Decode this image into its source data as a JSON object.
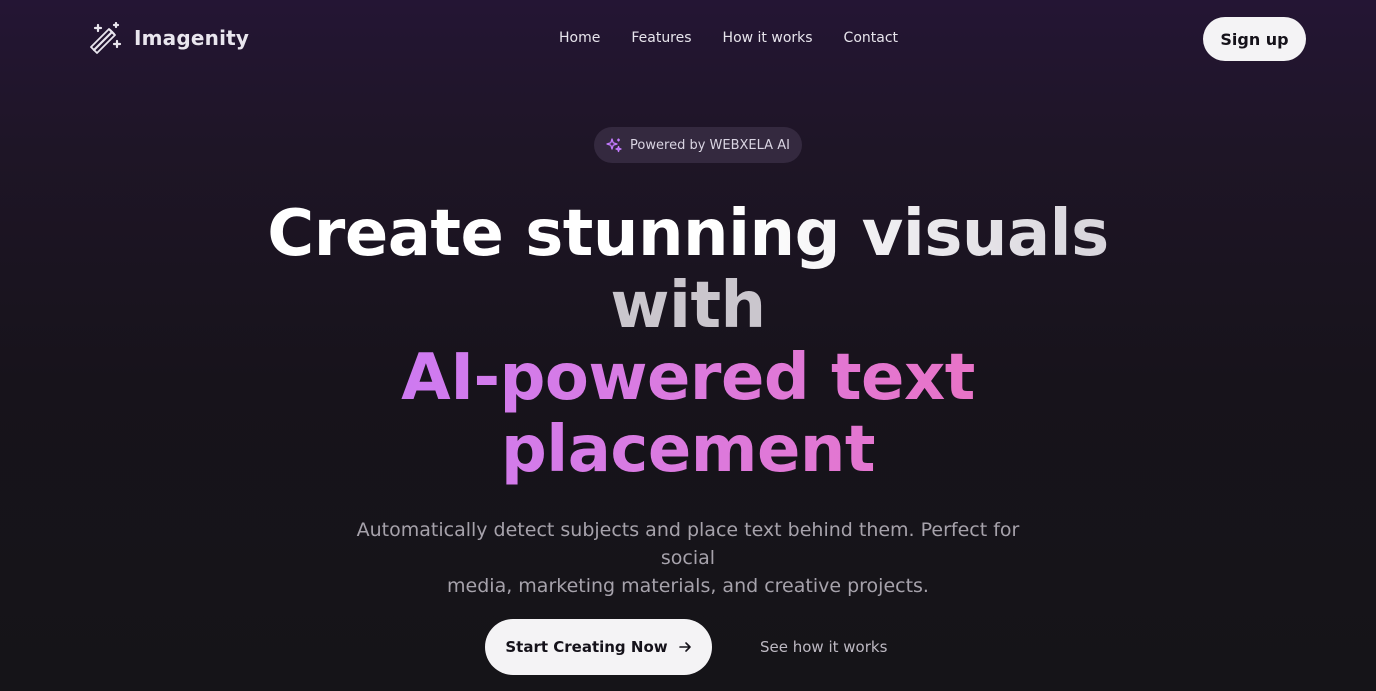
{
  "nav": {
    "brand": "Imagenity",
    "brand_icon": "magic-wand-icon",
    "links": [
      {
        "label": "Home"
      },
      {
        "label": "Features"
      },
      {
        "label": "How it works"
      },
      {
        "label": "Contact"
      }
    ],
    "signup_label": "Sign up"
  },
  "hero": {
    "badge": {
      "icon": "sparkles-icon",
      "text": "Powered by WEBXELA AI"
    },
    "headline": {
      "line1": "Create stunning visuals",
      "line2": "with",
      "line3": "AI-powered text",
      "line4": "placement"
    },
    "subtext_line1": "Automatically detect subjects and place text behind them. Perfect for social",
    "subtext_line2": "media, marketing materials, and creative projects.",
    "cta_primary": {
      "label": "Start Creating Now",
      "icon": "arrow-right-icon"
    },
    "cta_secondary": "See how it works"
  },
  "colors": {
    "background_top": "#241534",
    "background_bottom": "#151418",
    "accent_purple": "#c47aff",
    "accent_pink": "#f26fb6",
    "button_bg": "#f4f3f5"
  }
}
